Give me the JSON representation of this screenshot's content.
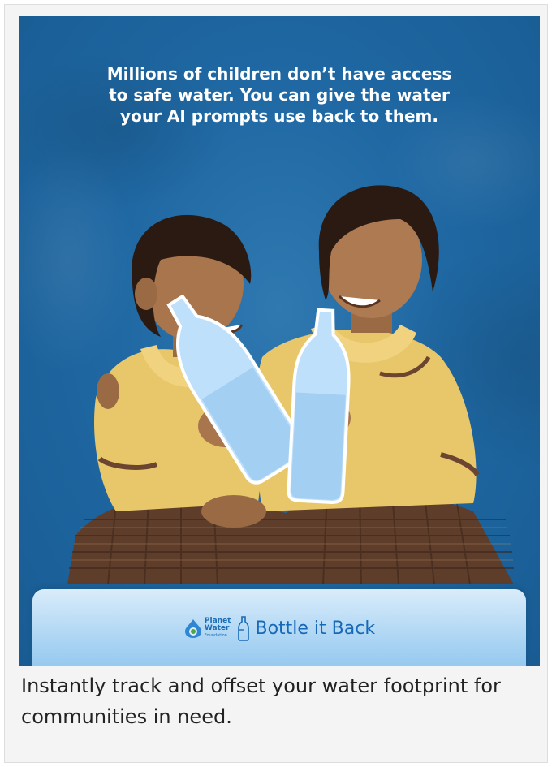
{
  "promo": {
    "headline": "Millions of children don’t have access\nto safe water. You can give the water\nyour AI prompts use back to them.",
    "brand": {
      "foundation_word1": "Planet",
      "foundation_word2": "Water",
      "foundation_word3": "Foundation",
      "product_name": "Bottle it Back"
    }
  },
  "caption": "Instantly track and offset your water footprint for communities in need.",
  "colors": {
    "background_blue": "#1f68a3",
    "uniform_yellow": "#e8c66a",
    "skirt_brown": "#6b4530",
    "brand_text_blue": "#1769b8",
    "bottle_blue": "#bfe0fa"
  },
  "icons": {
    "foundation_logo": "planet-water-logo-icon",
    "bottle": "bottle-outline-icon"
  }
}
